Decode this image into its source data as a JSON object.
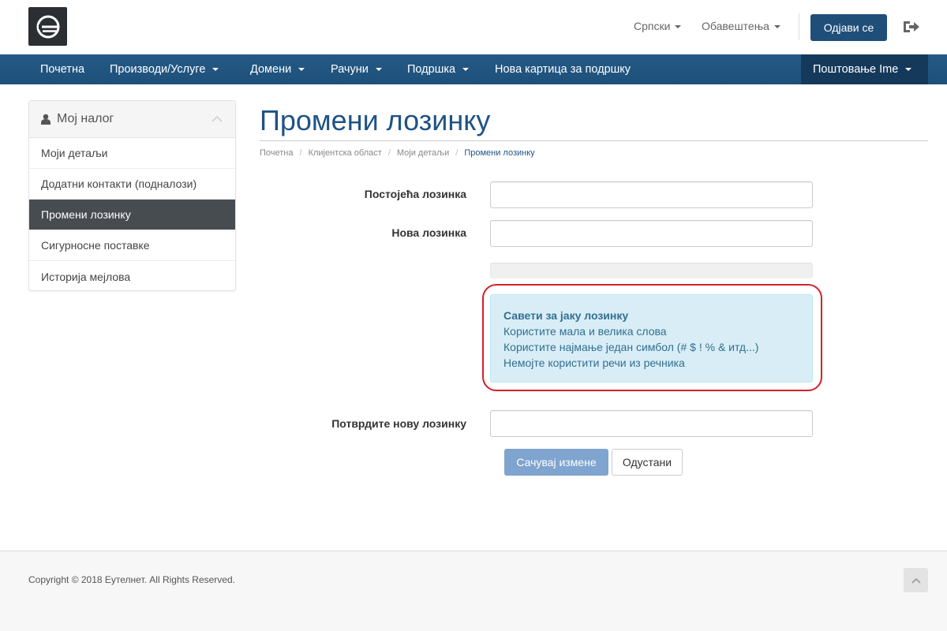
{
  "header": {
    "logo_icon": "e-circle-logo-icon",
    "language": "Српски",
    "notifications": "Обавештења",
    "logout": "Одјави се",
    "exit_icon": "sign-out-icon"
  },
  "nav": {
    "items": [
      {
        "label": "Почетна"
      },
      {
        "label": "Производи/Услуге"
      },
      {
        "label": "Домени"
      },
      {
        "label": "Рачуни"
      },
      {
        "label": "Подршка"
      },
      {
        "label": "Нова картица за подршку"
      }
    ],
    "account": "Поштовање Ime"
  },
  "sidebar": {
    "title": "Мој налог",
    "items": [
      {
        "label": "Моји детаљи"
      },
      {
        "label": "Додатни контакти (подналози)"
      },
      {
        "label": "Промени лозинку"
      },
      {
        "label": "Сигурносне поставке"
      },
      {
        "label": "Историја мејлова"
      }
    ]
  },
  "page": {
    "title": "Промени лозинку",
    "breadcrumb": [
      "Почетна",
      "Клијентска област",
      "Моји детаљи",
      "Промени лозинку"
    ]
  },
  "form": {
    "current_password_label": "Постојећа лозинка",
    "current_password_value": "",
    "new_password_label": "Нова лозинка",
    "new_password_value": "",
    "password_strength": 0,
    "confirm_password_label": "Потврдите нову лозинку",
    "confirm_password_value": "",
    "save_label": "Сачувај измене",
    "cancel_label": "Одустани"
  },
  "tips": {
    "title": "Савети за јаку лозинку",
    "lines": [
      "Користите мала и велика слова",
      "Користите најмање један симбол (# $ ! % & итд...)",
      "Немојте користити речи из речника"
    ]
  },
  "footer": {
    "copyright": "Copyright © 2018 Еутелнет. All Rights Reserved."
  },
  "colors": {
    "brand": "#1f4e79",
    "nav_bg": "#245a87",
    "sidebar_active": "#474c51",
    "tips_bg": "#d9edf7",
    "highlight": "#d4202a"
  }
}
